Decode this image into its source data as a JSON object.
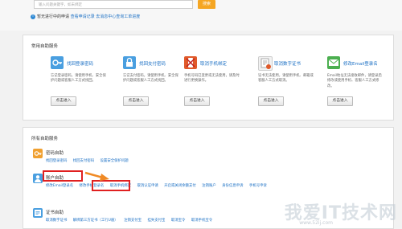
{
  "search": {
    "placeholder": "输入问题关键字，如未绑定",
    "button": "搜索"
  },
  "info": {
    "text": "暂无进行中的申请",
    "links": [
      "查看申请记录",
      "去消息中心查询工单进度"
    ]
  },
  "common": {
    "title": "常用自助服务",
    "cards": [
      {
        "title": "找回登录密码",
        "desc": "忘记登录密码，请使用手机、安全保护问题或客服人工方式找回。",
        "button": "点击进入",
        "icon": "key-icon",
        "color": "#4a9fe0"
      },
      {
        "title": "找回支付密码",
        "desc": "忘记支付密码，请使用手机、安全保护问题或客服人工方式找回。",
        "button": "点击进入",
        "icon": "lock-icon",
        "color": "#4a9fe0"
      },
      {
        "title": "取消手机绑定",
        "desc": "手机号码已变更或无法使用，请及时进行更换操作。",
        "button": "点击进入",
        "icon": "phone-cancel-icon",
        "color": "#e05a2a"
      },
      {
        "title": "取消数字证书",
        "desc": "证书无法使用，请使用手机、邮箱或客服人工方式取消。",
        "button": "点击进入",
        "icon": "certificate-icon",
        "color": "#e05a2a"
      },
      {
        "title": "修改Email登录名",
        "desc": "Email地址无法接收邮件，请登录后修改或使用手机、客服人工方式修改。",
        "button": "点击进入",
        "icon": "email-icon",
        "color": "#4caf50"
      }
    ]
  },
  "all": {
    "title": "所有自助服务",
    "sections": [
      {
        "title": "密码自助",
        "links": [
          "找回登录密码",
          "找回支付密码",
          "设置安全保护问题"
        ],
        "icon": "password-icon",
        "color": "#f0a030"
      },
      {
        "title": "账户自助",
        "links": [
          "修改Email登录名",
          "修改手机登录名",
          "取消手机绑定",
          "取消认证申请",
          "开启或关闭余额支付",
          "注销账户",
          "身份信息申诉",
          "手机号申诉"
        ],
        "icon": "account-icon",
        "color": "#4a9fe0"
      },
      {
        "title": "证书自助",
        "links": [
          "取消数字证书",
          "解绑第三方证书（工行U盾）",
          "注销支付宝",
          "挂失支付宝",
          "取消宝令",
          "取消手机宝令"
        ],
        "icon": "certificate-section-icon",
        "color": "#4a9fe0"
      }
    ]
  },
  "watermark": {
    "text": "我爱IT技术网",
    "sub": "www.52ij.com"
  }
}
